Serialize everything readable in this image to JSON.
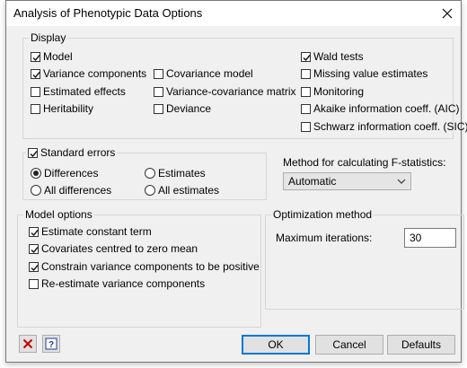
{
  "window": {
    "title": "Analysis of Phenotypic Data Options"
  },
  "display": {
    "legend": "Display",
    "items": [
      {
        "label": "Model",
        "checked": true
      },
      {
        "label": "Variance components",
        "checked": true
      },
      {
        "label": "Estimated effects",
        "checked": false
      },
      {
        "label": "Heritability",
        "checked": false
      },
      {
        "label": "Covariance model",
        "checked": false
      },
      {
        "label": "Variance-covariance matrix",
        "checked": false
      },
      {
        "label": "Deviance",
        "checked": false
      },
      {
        "label": "Wald tests",
        "checked": true
      },
      {
        "label": "Missing value estimates",
        "checked": false
      },
      {
        "label": "Monitoring",
        "checked": false
      },
      {
        "label": "Akaike information coeff. (AIC)",
        "checked": false
      },
      {
        "label": "Schwarz information coeff. (SIC)",
        "checked": false
      }
    ]
  },
  "standard_errors": {
    "legend": "Standard errors",
    "checked": true,
    "options": [
      {
        "label": "Differences",
        "selected": true
      },
      {
        "label": "Estimates",
        "selected": false
      },
      {
        "label": "All differences",
        "selected": false
      },
      {
        "label": "All estimates",
        "selected": false
      }
    ]
  },
  "fstat": {
    "label": "Method for calculating F-statistics:",
    "selected": "Automatic"
  },
  "model_options": {
    "legend": "Model options",
    "items": [
      {
        "label": "Estimate constant term",
        "checked": true
      },
      {
        "label": "Covariates centred to zero mean",
        "checked": true
      },
      {
        "label": "Constrain variance components to be positive",
        "checked": true
      },
      {
        "label": "Re-estimate variance components",
        "checked": false
      }
    ]
  },
  "optimization": {
    "legend": "Optimization method",
    "max_iter_label": "Maximum iterations:",
    "max_iter_value": "30"
  },
  "buttons": {
    "ok": "OK",
    "cancel": "Cancel",
    "defaults": "Defaults",
    "clear_icon": "red-x-icon",
    "help_icon": "help-question-icon"
  },
  "colors": {
    "accent": "#0078d7",
    "clear_red": "#c00000"
  }
}
